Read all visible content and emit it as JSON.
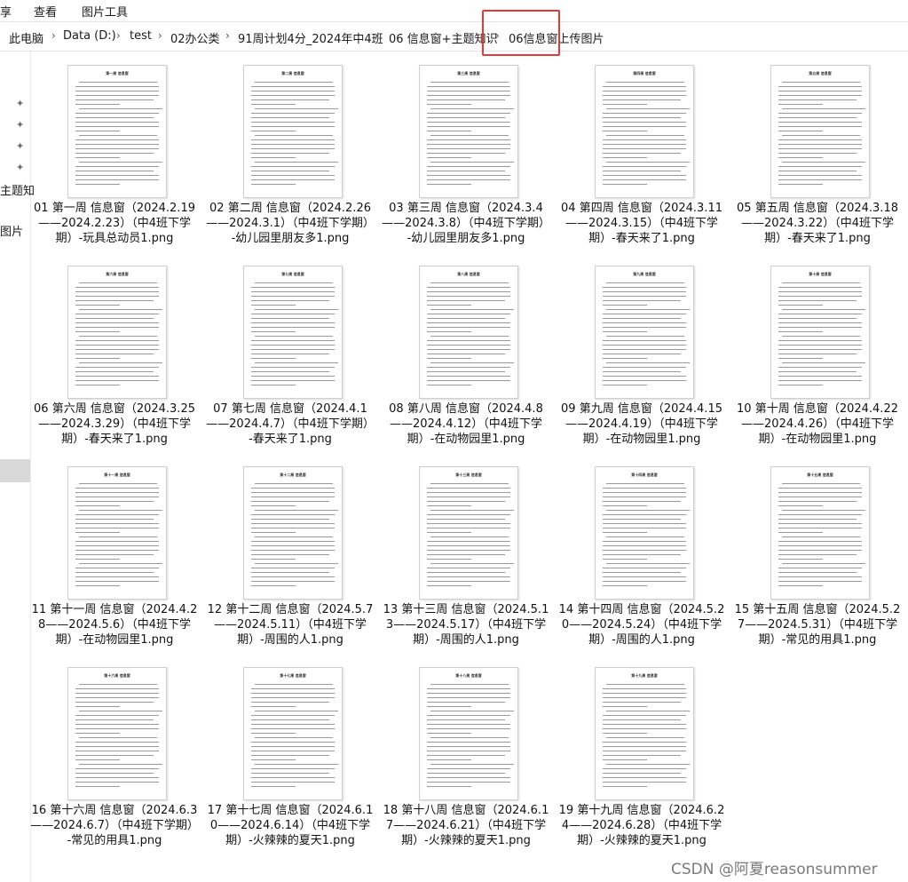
{
  "ribbon": {
    "tab1": "享",
    "tab2": "查看",
    "tab3": "图片工具"
  },
  "breadcrumb": [
    {
      "label": "此电脑"
    },
    {
      "label": "Data (D:)"
    },
    {
      "label": "test"
    },
    {
      "label": "02办公类"
    },
    {
      "label": "91周计划4分_2024年中4班"
    },
    {
      "label": "06 信息窗+主题知识"
    },
    {
      "label": "06信息窗上传图片"
    }
  ],
  "sidebar": {
    "label1": "主题知",
    "label2": "图片"
  },
  "files": [
    {
      "title": "第一周 信息窗",
      "caption": "01 第一周 信息窗（2024.2.19——2024.2.23）（中4班下学期）-玩具总动员1.png"
    },
    {
      "title": "第二周 信息窗",
      "caption": "02 第二周 信息窗（2024.2.26——2024.3.1）（中4班下学期）-幼儿园里朋友多1.png"
    },
    {
      "title": "第三周 信息窗",
      "caption": "03 第三周 信息窗（2024.3.4——2024.3.8）（中4班下学期）-幼儿园里朋友多1.png"
    },
    {
      "title": "第四周 信息窗",
      "caption": "04 第四周 信息窗（2024.3.11——2024.3.15）（中4班下学期）-春天来了1.png"
    },
    {
      "title": "第五周 信息窗",
      "caption": "05 第五周 信息窗（2024.3.18——2024.3.22）（中4班下学期）-春天来了1.png"
    },
    {
      "title": "第六周 信息窗",
      "caption": "06 第六周 信息窗（2024.3.25——2024.3.29）（中4班下学期）-春天来了1.png"
    },
    {
      "title": "第七周 信息窗",
      "caption": "07 第七周 信息窗（2024.4.1——2024.4.7）（中4班下学期）-春天来了1.png"
    },
    {
      "title": "第八周 信息窗",
      "caption": "08 第八周 信息窗（2024.4.8——2024.4.12）（中4班下学期）-在动物园里1.png"
    },
    {
      "title": "第九周 信息窗",
      "caption": "09 第九周 信息窗（2024.4.15——2024.4.19）（中4班下学期）-在动物园里1.png"
    },
    {
      "title": "第十周 信息窗",
      "caption": "10 第十周 信息窗（2024.4.22——2024.4.26）（中4班下学期）-在动物园里1.png"
    },
    {
      "title": "第十一周 信息窗",
      "caption": "11 第十一周 信息窗（2024.4.28——2024.5.6）（中4班下学期）-在动物园里1.png"
    },
    {
      "title": "第十二周 信息窗",
      "caption": "12 第十二周 信息窗（2024.5.7——2024.5.11）（中4班下学期）-周围的人1.png"
    },
    {
      "title": "第十三周 信息窗",
      "caption": "13 第十三周 信息窗（2024.5.13——2024.5.17）（中4班下学期）-周围的人1.png"
    },
    {
      "title": "第十四周 信息窗",
      "caption": "14 第十四周 信息窗（2024.5.20——2024.5.24）（中4班下学期）-周围的人1.png"
    },
    {
      "title": "第十五周 信息窗",
      "caption": "15 第十五周 信息窗（2024.5.27——2024.5.31）（中4班下学期）-常见的用具1.png"
    },
    {
      "title": "第十六周 信息窗",
      "caption": "16 第十六周 信息窗（2024.6.3——2024.6.7）（中4班下学期）-常见的用具1.png"
    },
    {
      "title": "第十七周 信息窗",
      "caption": "17 第十七周 信息窗（2024.6.10——2024.6.14）（中4班下学期）-火辣辣的夏天1.png"
    },
    {
      "title": "第十八周 信息窗",
      "caption": "18 第十八周 信息窗（2024.6.17——2024.6.21）（中4班下学期）-火辣辣的夏天1.png"
    },
    {
      "title": "第十九周 信息窗",
      "caption": "19 第十九周 信息窗（2024.6.24——2024.6.28）（中4班下学期）-火辣辣的夏天1.png"
    }
  ],
  "watermark": "CSDN @阿夏reasonsummer",
  "colors": {
    "highlight_box": "#e53935",
    "selection": "#d9d9d9"
  }
}
